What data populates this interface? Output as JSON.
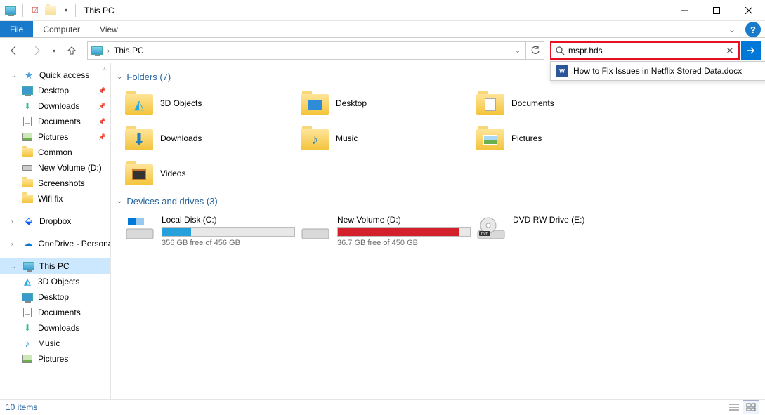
{
  "window": {
    "title": "This PC"
  },
  "ribbon": {
    "file": "File",
    "computer": "Computer",
    "view": "View"
  },
  "address": {
    "location": "This PC"
  },
  "search": {
    "value": "mspr.hds",
    "suggestion": "How to Fix Issues in Netflix Stored Data.docx"
  },
  "sidebar": {
    "quick_access": "Quick access",
    "desktop": "Desktop",
    "downloads": "Downloads",
    "documents": "Documents",
    "pictures": "Pictures",
    "common": "Common",
    "new_volume": "New Volume (D:)",
    "screenshots": "Screenshots",
    "wifi_fix": "Wifi fix",
    "dropbox": "Dropbox",
    "onedrive": "OneDrive - Personal",
    "this_pc": "This PC",
    "three_d": "3D Objects",
    "pc_desktop": "Desktop",
    "pc_documents": "Documents",
    "pc_downloads": "Downloads",
    "pc_music": "Music",
    "pc_pictures": "Pictures"
  },
  "sections": {
    "folders": {
      "label": "Folders (7)"
    },
    "drives": {
      "label": "Devices and drives (3)"
    }
  },
  "folders": {
    "three_d": "3D Objects",
    "desktop": "Desktop",
    "documents": "Documents",
    "downloads": "Downloads",
    "music": "Music",
    "pictures": "Pictures",
    "videos": "Videos"
  },
  "drives": {
    "c": {
      "name": "Local Disk (C:)",
      "free": "356 GB free of 456 GB",
      "fill_pct": 22,
      "fill_color": "#26a0da"
    },
    "d": {
      "name": "New Volume (D:)",
      "free": "36.7 GB free of 450 GB",
      "fill_pct": 92,
      "fill_color": "#d4202a"
    },
    "e": {
      "name": "DVD RW Drive (E:)"
    }
  },
  "status": {
    "items": "10 items"
  }
}
